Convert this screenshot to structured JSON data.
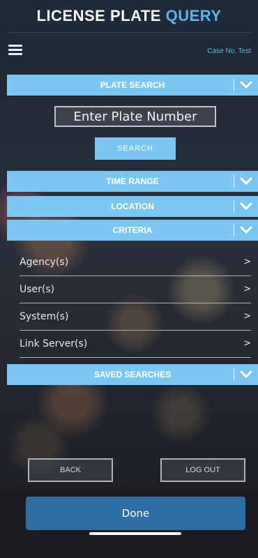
{
  "header": {
    "title_main": "LICENSE PLATE",
    "title_accent": "QUERY",
    "case_label": "Case No. Test",
    "menu_icon": "hamburger-menu-icon"
  },
  "sections": {
    "plate_search": "PLATE SEARCH",
    "time_range": "TIME RANGE",
    "location": "LOCATION",
    "criteria": "CRITERIA",
    "saved_searches": "SAVED SEARCHES",
    "chevron_icon": "chevron-down-icon"
  },
  "plate_search": {
    "placeholder": "Enter Plate Number",
    "search_label": "SEARCH"
  },
  "criteria_items": [
    {
      "label": "Agency(s)",
      "arrow": ">"
    },
    {
      "label": "User(s)",
      "arrow": ">"
    },
    {
      "label": "System(s)",
      "arrow": ">"
    },
    {
      "label": "Link Server(s)",
      "arrow": ">"
    }
  ],
  "footer": {
    "back_label": "BACK",
    "logout_label": "LOG OUT",
    "done_label": "Done"
  },
  "colors": {
    "accent": "#7cc7f2",
    "title_accent": "#5fb4ec",
    "done_button": "#2d6fa3",
    "header_bg": "#1e2a3a"
  }
}
